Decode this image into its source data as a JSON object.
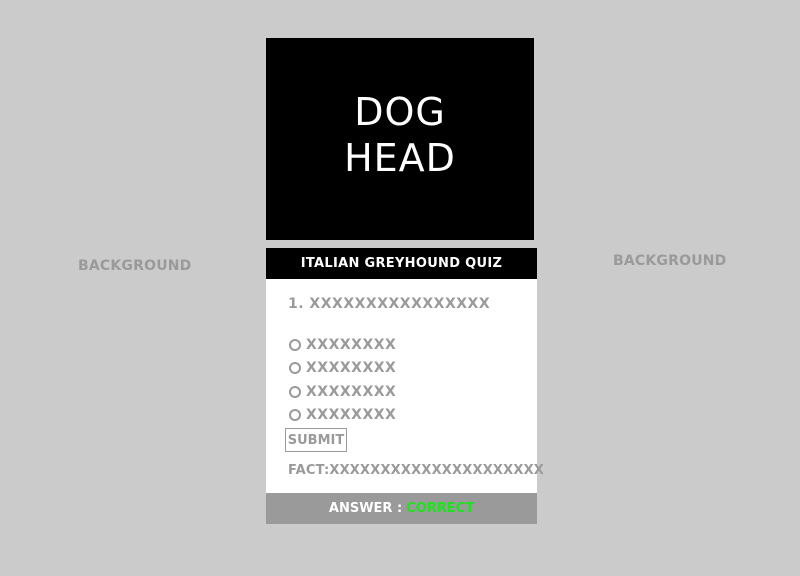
{
  "background": {
    "left_label": "BACKGROUND",
    "right_label": "BACKGROUND"
  },
  "hero": {
    "line1": "DOG",
    "line2": "HEAD"
  },
  "quiz": {
    "title": "ITALIAN GREYHOUND QUIZ",
    "question": "1. XXXXXXXXXXXXXXXX",
    "options": [
      "XXXXXXXX",
      "XXXXXXXX",
      "XXXXXXXX",
      "XXXXXXXX"
    ],
    "submit_label": "SUBMIT",
    "fact": "FACT:XXXXXXXXXXXXXXXXXXXXX",
    "answer_label": "ANSWER :",
    "answer_status": "CORRECT"
  },
  "colors": {
    "page_background": "#cbcbcb",
    "panel_black": "#000000",
    "muted_text": "#9a9a9a",
    "correct_green": "#1ee31e"
  }
}
